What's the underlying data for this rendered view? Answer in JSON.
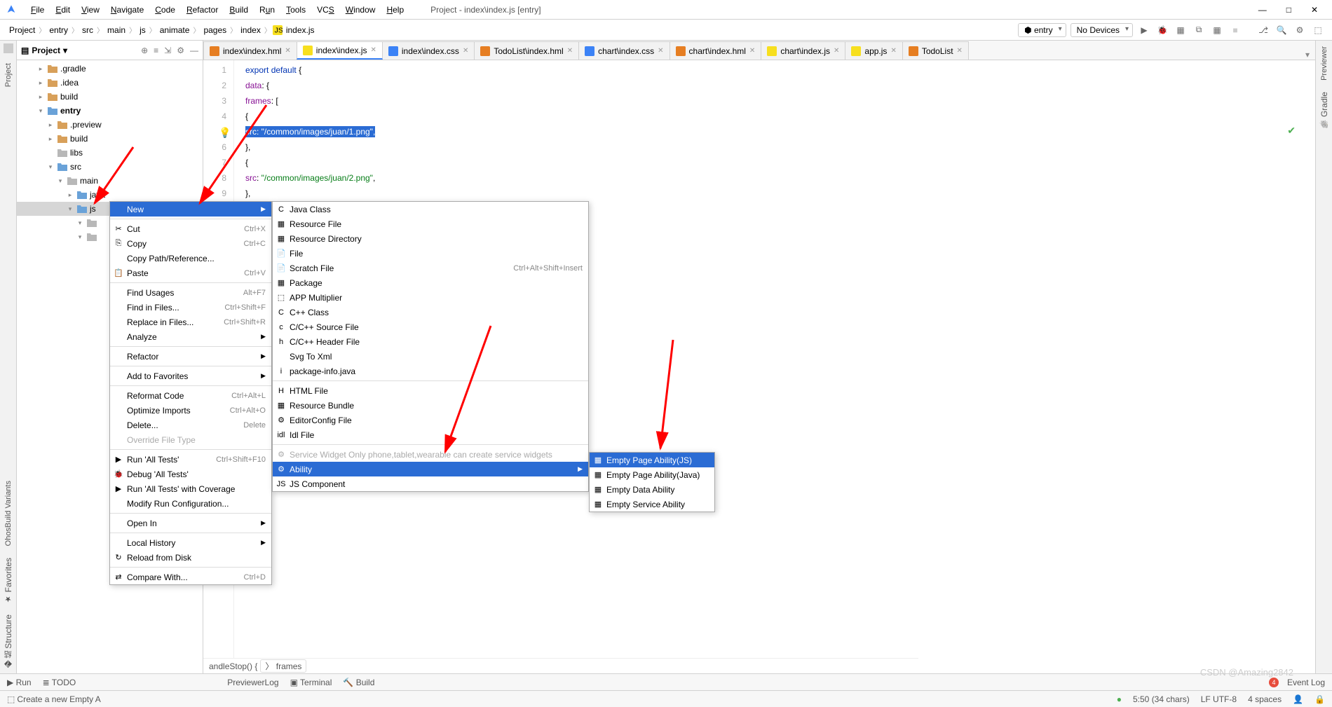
{
  "window": {
    "title": "Project - index\\index.js [entry]"
  },
  "menubar": [
    "File",
    "Edit",
    "View",
    "Navigate",
    "Code",
    "Refactor",
    "Build",
    "Run",
    "Tools",
    "VCS",
    "Window",
    "Help"
  ],
  "window_controls": {
    "min": "—",
    "max": "□",
    "close": "✕"
  },
  "breadcrumbs": [
    "Project",
    "entry",
    "src",
    "main",
    "js",
    "animate",
    "pages",
    "index",
    "index.js"
  ],
  "run_config": "entry",
  "devices": "No Devices",
  "project_panel": {
    "title": "Project",
    "tree": [
      {
        "l": 2,
        "t": "arrow",
        "a": "▸",
        "icon": "folder",
        "label": ".gradle"
      },
      {
        "l": 2,
        "t": "arrow",
        "a": "▸",
        "icon": "folder",
        "label": ".idea"
      },
      {
        "l": 2,
        "t": "arrow",
        "a": "▸",
        "icon": "folder",
        "label": "build"
      },
      {
        "l": 2,
        "t": "arrow",
        "a": "▾",
        "icon": "folder-blue",
        "label": "entry",
        "bold": true
      },
      {
        "l": 3,
        "t": "arrow",
        "a": "▸",
        "icon": "folder",
        "label": ".preview"
      },
      {
        "l": 3,
        "t": "arrow",
        "a": "▸",
        "icon": "folder",
        "label": "build"
      },
      {
        "l": 3,
        "t": "none",
        "a": "",
        "icon": "folder-gray",
        "label": "libs"
      },
      {
        "l": 3,
        "t": "arrow",
        "a": "▾",
        "icon": "folder-blue",
        "label": "src"
      },
      {
        "l": 4,
        "t": "arrow",
        "a": "▾",
        "icon": "folder-gray",
        "label": "main"
      },
      {
        "l": 5,
        "t": "arrow",
        "a": "▸",
        "icon": "folder-blue",
        "label": "java"
      },
      {
        "l": 5,
        "t": "arrow",
        "a": "▾",
        "icon": "folder-blue",
        "label": "js",
        "selected": true
      },
      {
        "l": 6,
        "t": "arrow",
        "a": "▾",
        "icon": "folder-gray",
        "label": ""
      },
      {
        "l": 6,
        "t": "arrow",
        "a": "▾",
        "icon": "folder-gray",
        "label": ""
      }
    ]
  },
  "tabs": [
    {
      "label": "index\\index.hml",
      "icon": "hml"
    },
    {
      "label": "index\\index.js",
      "icon": "js",
      "active": true
    },
    {
      "label": "index\\index.css",
      "icon": "css"
    },
    {
      "label": "TodoList\\index.hml",
      "icon": "hml"
    },
    {
      "label": "chart\\index.css",
      "icon": "css"
    },
    {
      "label": "chart\\index.hml",
      "icon": "hml"
    },
    {
      "label": "chart\\index.js",
      "icon": "js"
    },
    {
      "label": "app.js",
      "icon": "js"
    },
    {
      "label": "TodoList",
      "icon": "hml"
    }
  ],
  "code_lines": [
    {
      "n": 1,
      "html": "<span class='kw'>export</span> <span class='kw'>default</span> <span class='brk'>{</span>"
    },
    {
      "n": 2,
      "html": "    <span class='key'>data</span>: <span class='brk'>{</span>"
    },
    {
      "n": 3,
      "html": "        <span class='key'>frames</span>: <span class='brk'>[</span>"
    },
    {
      "n": 4,
      "html": "            <span class='brk'>{</span>"
    },
    {
      "n": 5,
      "html": "                <span class='sel'><span class='key'>src</span>: <span class='str'>\"/common/images/juan/1.png\"</span>,</span>"
    },
    {
      "n": 6,
      "html": "            <span class='brk'>}</span>,"
    },
    {
      "n": 7,
      "html": "            <span class='brk'>{</span>"
    },
    {
      "n": 8,
      "html": "                <span class='key'>src</span>: <span class='str'>\"/common/images/juan/2.png\"</span>,"
    },
    {
      "n": 9,
      "html": "            <span class='brk'>}</span>,"
    }
  ],
  "ctx_menu_1": [
    {
      "label": "New",
      "icon": "",
      "hl": true,
      "sub": true
    },
    {
      "sep": true
    },
    {
      "label": "Cut",
      "icon": "✂",
      "shortcut": "Ctrl+X"
    },
    {
      "label": "Copy",
      "icon": "⎘",
      "shortcut": "Ctrl+C"
    },
    {
      "label": "Copy Path/Reference...",
      "icon": ""
    },
    {
      "label": "Paste",
      "icon": "📋",
      "shortcut": "Ctrl+V"
    },
    {
      "sep": true
    },
    {
      "label": "Find Usages",
      "shortcut": "Alt+F7"
    },
    {
      "label": "Find in Files...",
      "shortcut": "Ctrl+Shift+F"
    },
    {
      "label": "Replace in Files...",
      "shortcut": "Ctrl+Shift+R"
    },
    {
      "label": "Analyze",
      "sub": true
    },
    {
      "sep": true
    },
    {
      "label": "Refactor",
      "sub": true
    },
    {
      "sep": true
    },
    {
      "label": "Add to Favorites",
      "sub": true
    },
    {
      "sep": true
    },
    {
      "label": "Reformat Code",
      "shortcut": "Ctrl+Alt+L"
    },
    {
      "label": "Optimize Imports",
      "shortcut": "Ctrl+Alt+O"
    },
    {
      "label": "Delete...",
      "shortcut": "Delete"
    },
    {
      "label": "Override File Type",
      "disabled": true
    },
    {
      "sep": true
    },
    {
      "label": "Run 'All Tests'",
      "icon": "▶",
      "shortcut": "Ctrl+Shift+F10"
    },
    {
      "label": "Debug 'All Tests'",
      "icon": "🐞"
    },
    {
      "label": "Run 'All Tests' with Coverage",
      "icon": "▶"
    },
    {
      "label": "Modify Run Configuration...",
      "icon": ""
    },
    {
      "sep": true
    },
    {
      "label": "Open In",
      "sub": true
    },
    {
      "sep": true
    },
    {
      "label": "Local History",
      "sub": true
    },
    {
      "label": "Reload from Disk",
      "icon": "↻"
    },
    {
      "sep": true
    },
    {
      "label": "Compare With...",
      "icon": "⇄",
      "shortcut": "Ctrl+D"
    }
  ],
  "ctx_menu_2": [
    {
      "label": "Java Class",
      "icon": "C"
    },
    {
      "label": "Resource File",
      "icon": "▦"
    },
    {
      "label": "Resource Directory",
      "icon": "▦"
    },
    {
      "label": "File",
      "icon": "📄"
    },
    {
      "label": "Scratch File",
      "icon": "📄",
      "shortcut": "Ctrl+Alt+Shift+Insert"
    },
    {
      "label": "Package",
      "icon": "▦"
    },
    {
      "label": "APP Multiplier",
      "icon": "⬚"
    },
    {
      "label": "C++ Class",
      "icon": "C"
    },
    {
      "label": "C/C++ Source File",
      "icon": "c"
    },
    {
      "label": "C/C++ Header File",
      "icon": "h"
    },
    {
      "label": "Svg To Xml"
    },
    {
      "label": "package-info.java",
      "icon": "i"
    },
    {
      "sep": true
    },
    {
      "label": "HTML File",
      "icon": "H"
    },
    {
      "label": "Resource Bundle",
      "icon": "▦"
    },
    {
      "label": "EditorConfig File",
      "icon": "⚙"
    },
    {
      "label": "Idl File",
      "icon": "idl"
    },
    {
      "sep": true
    },
    {
      "label": "Service Widget Only phone,tablet,wearable can create service widgets",
      "icon": "⚙",
      "disabled": true
    },
    {
      "label": "Ability",
      "icon": "⚙",
      "hl": true,
      "sub": true
    },
    {
      "label": "JS Component",
      "icon": "JS"
    }
  ],
  "ctx_menu_3": [
    {
      "label": "Empty Page Ability(JS)",
      "icon": "▦",
      "hl": true
    },
    {
      "label": "Empty Page Ability(Java)",
      "icon": "▦"
    },
    {
      "label": "Empty Data Ability",
      "icon": "▦"
    },
    {
      "label": "Empty Service Ability",
      "icon": "▦"
    }
  ],
  "left_tabs": [
    "Project"
  ],
  "left_tabs_bottom": [
    "OhosBuild Variants",
    "Favorites",
    "Structure"
  ],
  "right_tabs": [
    "Previewer",
    "Gradle"
  ],
  "bottom_crumbs": [
    "andleStop()  {",
    "frames"
  ],
  "bottom_tools": {
    "left": [
      "Run",
      "TODO",
      "PreviewerLog",
      "Terminal",
      "Build"
    ],
    "right_label": "Event Log"
  },
  "statusbar": {
    "left": "Create a new Empty A",
    "caret": "5:50 (34 chars)",
    "encoding": "LF  UTF-8",
    "indent": "4 spaces"
  },
  "watermark": "CSDN @Amazing2842"
}
